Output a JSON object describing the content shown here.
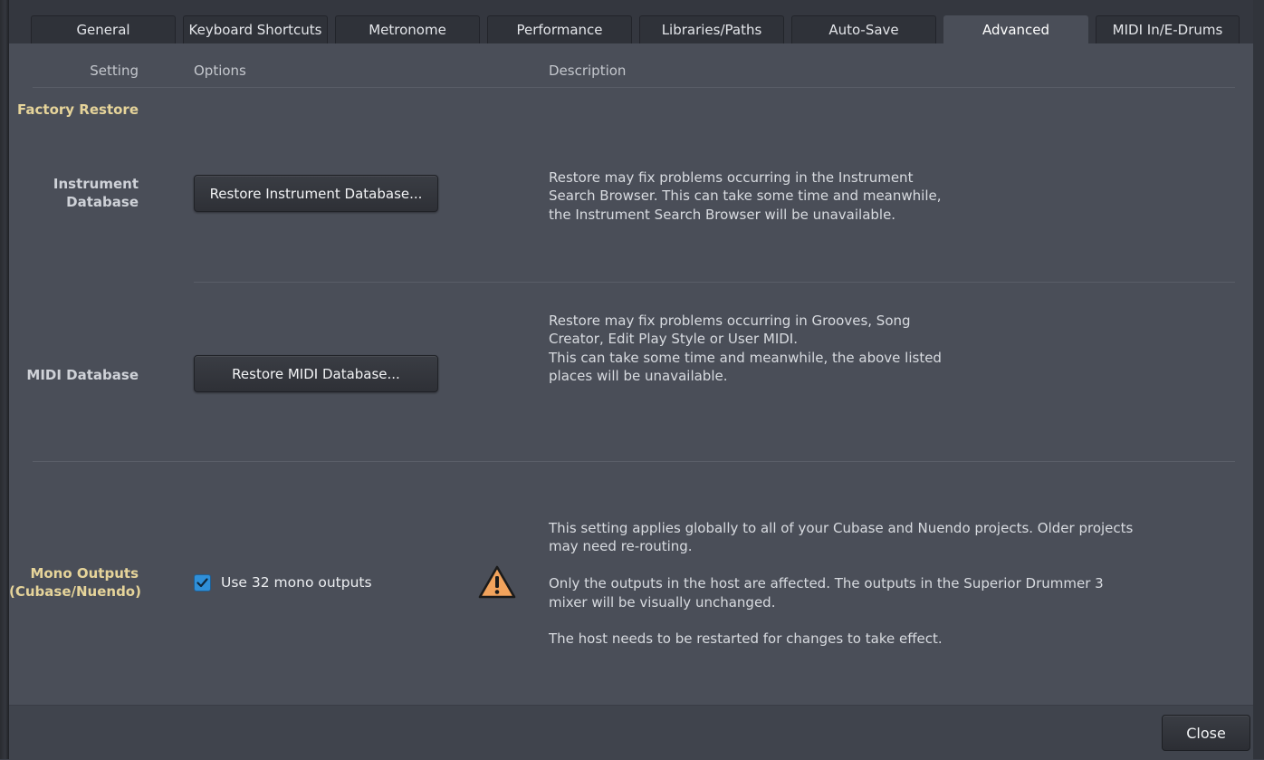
{
  "tabs": [
    {
      "label": "General"
    },
    {
      "label": "Keyboard Shortcuts"
    },
    {
      "label": "Metronome"
    },
    {
      "label": "Performance"
    },
    {
      "label": "Libraries/Paths"
    },
    {
      "label": "Auto-Save"
    },
    {
      "label": "Advanced",
      "active": true
    },
    {
      "label": "MIDI In/E-Drums"
    }
  ],
  "columns": {
    "setting": "Setting",
    "options": "Options",
    "description": "Description"
  },
  "factory_restore": {
    "title": "Factory Restore",
    "instrument_db": {
      "label": "Instrument\nDatabase",
      "button": "Restore Instrument Database...",
      "description": "Restore may fix problems occurring in the Instrument\nSearch Browser. This can take some time and meanwhile,\nthe Instrument Search Browser will be unavailable."
    },
    "midi_db": {
      "label": "MIDI Database",
      "button": "Restore MIDI Database...",
      "description": "Restore may fix problems occurring in Grooves, Song\nCreator, Edit Play Style or User MIDI.\nThis can take some time and meanwhile, the above listed\nplaces will be unavailable."
    }
  },
  "mono_outputs": {
    "label": "Mono Outputs\n(Cubase/Nuendo)",
    "checkbox_label": "Use 32 mono outputs",
    "checked": true,
    "description": "This setting applies globally to all of your Cubase and Nuendo projects. Older projects\nmay need re-routing.\n\nOnly the outputs in the host are affected. The outputs in the Superior Drummer 3\nmixer will be visually unchanged.\n\nThe host needs to be restarted for changes to take effect."
  },
  "footer": {
    "close_label": "Close"
  },
  "colors": {
    "section_title": "#e6d49a",
    "checkbox": "#2f8fd8",
    "warning": "#f2a35c"
  }
}
